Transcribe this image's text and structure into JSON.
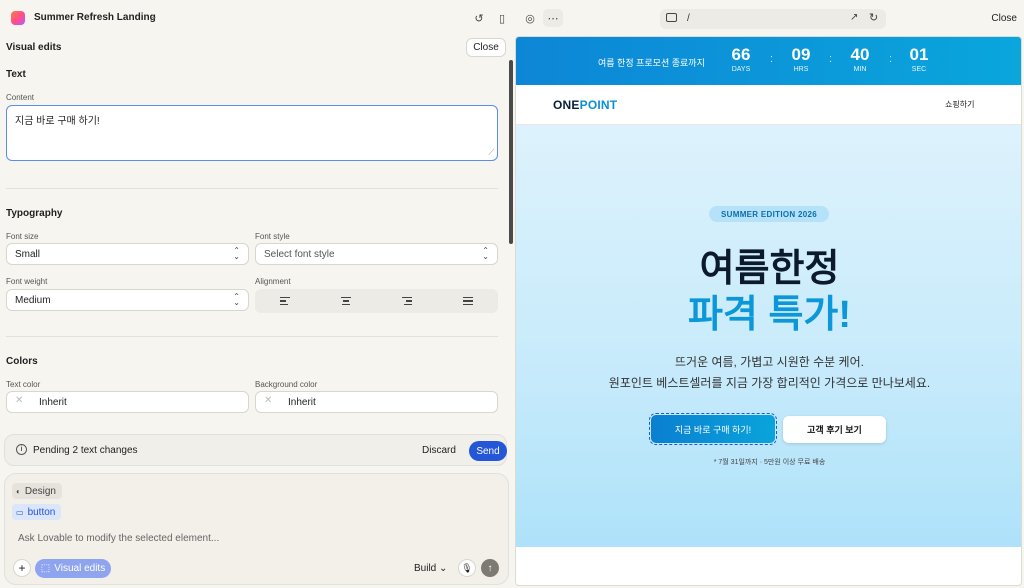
{
  "topbar": {
    "project_title": "Summer Refresh Landing",
    "url_path": "/",
    "close_label": "Close"
  },
  "visual_edits": {
    "title": "Visual edits",
    "close_label": "Close",
    "text_section": {
      "heading": "Text",
      "content_label": "Content",
      "content_value": "지금 바로 구매 하기!"
    },
    "typography": {
      "heading": "Typography",
      "font_size_label": "Font size",
      "font_size_value": "Small",
      "font_style_label": "Font style",
      "font_style_placeholder": "Select font style",
      "font_weight_label": "Font weight",
      "font_weight_value": "Medium",
      "alignment_label": "Alignment"
    },
    "colors": {
      "heading": "Colors",
      "text_color_label": "Text color",
      "text_color_value": "Inherit",
      "bg_color_label": "Background color",
      "bg_color_value": "Inherit"
    }
  },
  "pending": {
    "message": "Pending 2 text changes",
    "discard_label": "Discard",
    "send_label": "Send"
  },
  "chat": {
    "chip_design": "Design",
    "chip_button": "button",
    "placeholder": "Ask Lovable to modify the selected element...",
    "visual_edits_label": "Visual edits",
    "build_label": "Build"
  },
  "preview": {
    "countdown_label": "여름 한정 프로모션 종료까지",
    "countdown": [
      {
        "value": "66",
        "unit": "DAYS"
      },
      {
        "value": "09",
        "unit": "HRS"
      },
      {
        "value": "40",
        "unit": "MIN"
      },
      {
        "value": "01",
        "unit": "SEC"
      }
    ],
    "brand_one": "ONE",
    "brand_point": "POINT",
    "nav_link": "쇼핑하기",
    "badge": "SUMMER EDITION 2026",
    "headline_1": "여름한정",
    "headline_2": "파격 특가!",
    "subtext_1": "뜨거운 여름, 가볍고 시원한 수분 케어.",
    "subtext_2": "원포인트 베스트셀러를 지금 가장 합리적인 가격으로 만나보세요.",
    "cta_primary": "지금 바로 구매 하기!",
    "cta_secondary": "고객 후기 보기",
    "note": "* 7월 31일까지 · 5만원 이상 무료 배송"
  },
  "colors": {
    "accent_blue": "#2456d8",
    "hero_blue": "#0b97d8"
  }
}
